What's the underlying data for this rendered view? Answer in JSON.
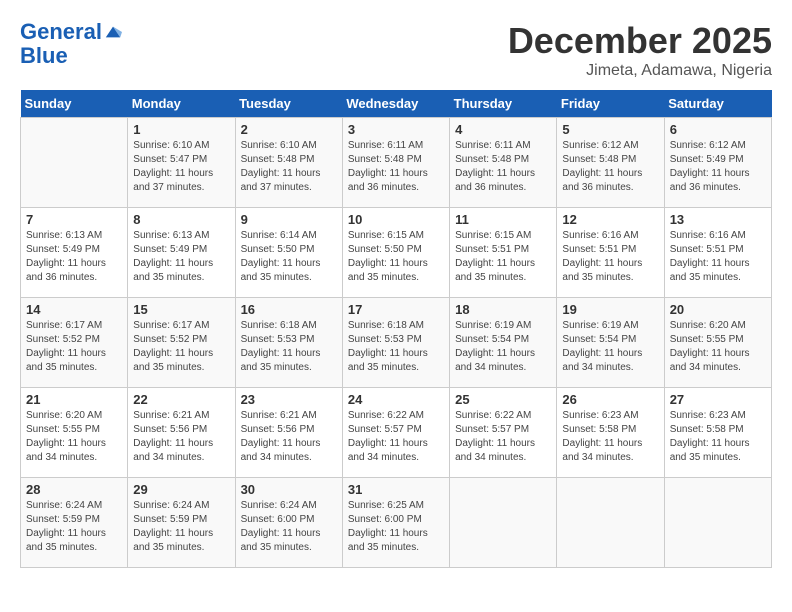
{
  "logo": {
    "line1": "General",
    "line2": "Blue"
  },
  "title": "December 2025",
  "location": "Jimeta, Adamawa, Nigeria",
  "weekdays": [
    "Sunday",
    "Monday",
    "Tuesday",
    "Wednesday",
    "Thursday",
    "Friday",
    "Saturday"
  ],
  "weeks": [
    [
      {
        "day": "",
        "info": ""
      },
      {
        "day": "1",
        "info": "Sunrise: 6:10 AM\nSunset: 5:47 PM\nDaylight: 11 hours\nand 37 minutes."
      },
      {
        "day": "2",
        "info": "Sunrise: 6:10 AM\nSunset: 5:48 PM\nDaylight: 11 hours\nand 37 minutes."
      },
      {
        "day": "3",
        "info": "Sunrise: 6:11 AM\nSunset: 5:48 PM\nDaylight: 11 hours\nand 36 minutes."
      },
      {
        "day": "4",
        "info": "Sunrise: 6:11 AM\nSunset: 5:48 PM\nDaylight: 11 hours\nand 36 minutes."
      },
      {
        "day": "5",
        "info": "Sunrise: 6:12 AM\nSunset: 5:48 PM\nDaylight: 11 hours\nand 36 minutes."
      },
      {
        "day": "6",
        "info": "Sunrise: 6:12 AM\nSunset: 5:49 PM\nDaylight: 11 hours\nand 36 minutes."
      }
    ],
    [
      {
        "day": "7",
        "info": "Sunrise: 6:13 AM\nSunset: 5:49 PM\nDaylight: 11 hours\nand 36 minutes."
      },
      {
        "day": "8",
        "info": "Sunrise: 6:13 AM\nSunset: 5:49 PM\nDaylight: 11 hours\nand 35 minutes."
      },
      {
        "day": "9",
        "info": "Sunrise: 6:14 AM\nSunset: 5:50 PM\nDaylight: 11 hours\nand 35 minutes."
      },
      {
        "day": "10",
        "info": "Sunrise: 6:15 AM\nSunset: 5:50 PM\nDaylight: 11 hours\nand 35 minutes."
      },
      {
        "day": "11",
        "info": "Sunrise: 6:15 AM\nSunset: 5:51 PM\nDaylight: 11 hours\nand 35 minutes."
      },
      {
        "day": "12",
        "info": "Sunrise: 6:16 AM\nSunset: 5:51 PM\nDaylight: 11 hours\nand 35 minutes."
      },
      {
        "day": "13",
        "info": "Sunrise: 6:16 AM\nSunset: 5:51 PM\nDaylight: 11 hours\nand 35 minutes."
      }
    ],
    [
      {
        "day": "14",
        "info": "Sunrise: 6:17 AM\nSunset: 5:52 PM\nDaylight: 11 hours\nand 35 minutes."
      },
      {
        "day": "15",
        "info": "Sunrise: 6:17 AM\nSunset: 5:52 PM\nDaylight: 11 hours\nand 35 minutes."
      },
      {
        "day": "16",
        "info": "Sunrise: 6:18 AM\nSunset: 5:53 PM\nDaylight: 11 hours\nand 35 minutes."
      },
      {
        "day": "17",
        "info": "Sunrise: 6:18 AM\nSunset: 5:53 PM\nDaylight: 11 hours\nand 35 minutes."
      },
      {
        "day": "18",
        "info": "Sunrise: 6:19 AM\nSunset: 5:54 PM\nDaylight: 11 hours\nand 34 minutes."
      },
      {
        "day": "19",
        "info": "Sunrise: 6:19 AM\nSunset: 5:54 PM\nDaylight: 11 hours\nand 34 minutes."
      },
      {
        "day": "20",
        "info": "Sunrise: 6:20 AM\nSunset: 5:55 PM\nDaylight: 11 hours\nand 34 minutes."
      }
    ],
    [
      {
        "day": "21",
        "info": "Sunrise: 6:20 AM\nSunset: 5:55 PM\nDaylight: 11 hours\nand 34 minutes."
      },
      {
        "day": "22",
        "info": "Sunrise: 6:21 AM\nSunset: 5:56 PM\nDaylight: 11 hours\nand 34 minutes."
      },
      {
        "day": "23",
        "info": "Sunrise: 6:21 AM\nSunset: 5:56 PM\nDaylight: 11 hours\nand 34 minutes."
      },
      {
        "day": "24",
        "info": "Sunrise: 6:22 AM\nSunset: 5:57 PM\nDaylight: 11 hours\nand 34 minutes."
      },
      {
        "day": "25",
        "info": "Sunrise: 6:22 AM\nSunset: 5:57 PM\nDaylight: 11 hours\nand 34 minutes."
      },
      {
        "day": "26",
        "info": "Sunrise: 6:23 AM\nSunset: 5:58 PM\nDaylight: 11 hours\nand 34 minutes."
      },
      {
        "day": "27",
        "info": "Sunrise: 6:23 AM\nSunset: 5:58 PM\nDaylight: 11 hours\nand 35 minutes."
      }
    ],
    [
      {
        "day": "28",
        "info": "Sunrise: 6:24 AM\nSunset: 5:59 PM\nDaylight: 11 hours\nand 35 minutes."
      },
      {
        "day": "29",
        "info": "Sunrise: 6:24 AM\nSunset: 5:59 PM\nDaylight: 11 hours\nand 35 minutes."
      },
      {
        "day": "30",
        "info": "Sunrise: 6:24 AM\nSunset: 6:00 PM\nDaylight: 11 hours\nand 35 minutes."
      },
      {
        "day": "31",
        "info": "Sunrise: 6:25 AM\nSunset: 6:00 PM\nDaylight: 11 hours\nand 35 minutes."
      },
      {
        "day": "",
        "info": ""
      },
      {
        "day": "",
        "info": ""
      },
      {
        "day": "",
        "info": ""
      }
    ]
  ]
}
